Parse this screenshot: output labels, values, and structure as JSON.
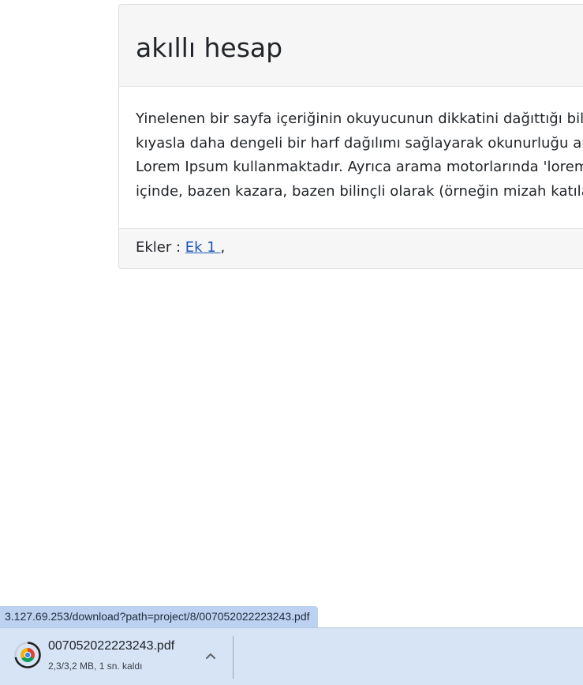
{
  "card": {
    "title": "akıllı hesap",
    "body_lines": [
      "Yinelenen bir sayfa içeriğinin okuyucunun dikkatini dağıttığı bilinen bir gerçektir. Lorem Ipsum kullanmanın amacı, sürekli 'buraya metin gelecek, buraya metin gelecek' yazmaya",
      "kıyasla daha dengeli bir harf dağılımı sağlayarak okunurluğu artırmasıdır. Şu anda birçok masaüstü yayıncılık paketi ve web sayfa düzenleyicisi, varsayılan mıgır metinler olarak",
      "Lorem Ipsum kullanmaktadır. Ayrıca arama motorlarında 'lorem ipsum' anahtar sözcükleri ile arama yapıldığında henüz tasarım aşamasında olan çok sayıda site listelenir. Yıllar",
      "içinde, bazen kazara, bazen bilinçli olarak (örneğin mizah katılarak), çeşitli sürümleri geliştirilmiştir."
    ],
    "attachments_label": "Ekler : ",
    "attachment_link": "Ek 1 ",
    "attachment_separator": ","
  },
  "status_bar": {
    "url": "3.127.69.253/download?path=project/8/007052022223243.pdf"
  },
  "download": {
    "filename": "007052022223243.pdf",
    "progress_text": "2,3/3,2 MB, 1 sn. kaldı",
    "progress_fraction": 0.72,
    "icon": "chrome-icon",
    "menu_icon": "chevron-up-icon"
  }
}
